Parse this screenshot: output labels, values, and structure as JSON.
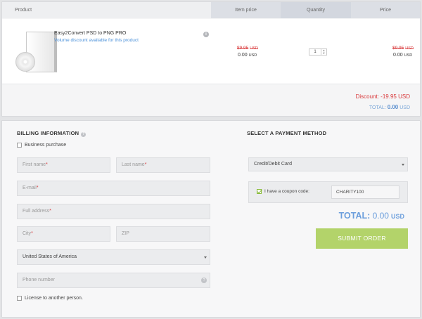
{
  "table": {
    "headers": {
      "product": "Product",
      "item_price": "Item price",
      "quantity": "Quantity",
      "price": "Price"
    },
    "product": {
      "name": "Easy2Convert PSD to PNG PRO",
      "volume_link": "Volume discount available for this product",
      "info_icon": "info-icon",
      "item_price_old": "$9.95",
      "item_price_old_cur": "USD",
      "item_price_new": "0.00",
      "item_price_new_cur": "USD",
      "quantity": "1",
      "price_old": "$9.95",
      "price_old_cur": "USD",
      "price_new": "0.00",
      "price_new_cur": "USD"
    },
    "discount_label": "Discount: -19.95",
    "discount_cur": "USD",
    "total_label": "TOTAL:",
    "total_value": "0.00",
    "total_cur": "USD"
  },
  "billing": {
    "title": "BILLING INFORMATION",
    "business_label": "Business purchase",
    "first_name": "First name",
    "last_name": "Last name",
    "email": "E-mail",
    "address": "Full address",
    "city": "City",
    "zip": "ZIP",
    "country": "United States of America",
    "phone": "Phone number",
    "license_label": "License to another person.",
    "required_mark": "*"
  },
  "payment": {
    "title": "SELECT A PAYMENT METHOD",
    "method": "Credit/Debit Card",
    "coupon_label": "I have a coupon code:",
    "coupon_value": "CHARITY100",
    "total_label": "TOTAL:",
    "total_value": "0.00",
    "total_cur": "USD",
    "submit_label": "SUBMIT ORDER"
  },
  "colors": {
    "accent_blue": "#6b9edc",
    "discount_red": "#d9393b",
    "submit_green": "#b3d36a"
  }
}
